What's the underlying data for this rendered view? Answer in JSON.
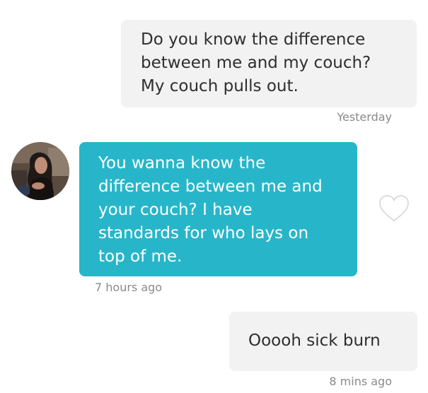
{
  "messages": [
    {
      "text": "Do you know the difference\nbetween me and my couch?\nMy couch pulls out.",
      "time": "Yesterday"
    },
    {
      "text": "You wanna know the\ndifference between me and\nyour couch? I have\nstandards for who lays on\ntop of me.",
      "time": "7 hours ago"
    },
    {
      "text": "Ooooh sick burn",
      "time": "8 mins ago"
    }
  ],
  "icons": {
    "like": "heart-outline-icon",
    "avatar": "profile-photo"
  },
  "colors": {
    "outgoing_bubble": "#f2f2f2",
    "incoming_bubble": "#27b6c9",
    "outgoing_text": "#2e2e2e",
    "incoming_text": "#ffffff",
    "timestamp": "#8a8a8a",
    "heart_outline": "#dcdcdc"
  }
}
